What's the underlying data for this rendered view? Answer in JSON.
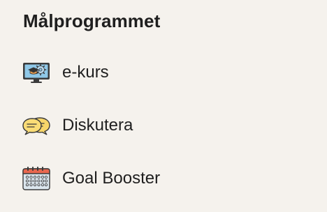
{
  "section": {
    "title": "Målprogrammet"
  },
  "menu": {
    "items": [
      {
        "label": "e-kurs",
        "icon": "monitor-graduation-cap-icon"
      },
      {
        "label": "Diskutera",
        "icon": "speech-bubbles-icon"
      },
      {
        "label": "Goal Booster",
        "icon": "calendar-icon"
      }
    ]
  },
  "colors": {
    "background": "#f5f2ed",
    "text": "#1f1f1f",
    "monitor_screen": "#8fc8e8",
    "bubble_yellow": "#f7d66a",
    "calendar_header": "#e8674f",
    "calendar_body": "#dbe6ee"
  }
}
